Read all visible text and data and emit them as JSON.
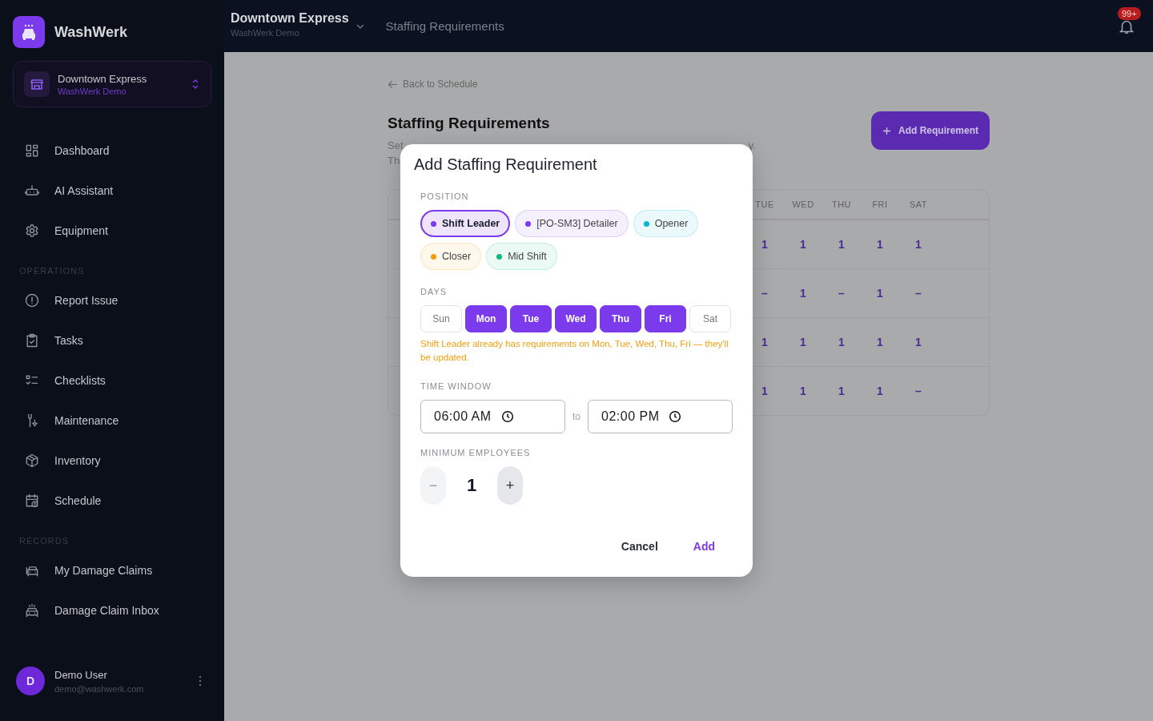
{
  "sidebar": {
    "brand": "WashWerk",
    "store": {
      "name": "Downtown Express",
      "org": "WashWerk Demo"
    },
    "sections": [
      {
        "items": [
          {
            "label": "Dashboard",
            "kind": "grid"
          },
          {
            "label": "AI Assistant",
            "kind": "robot"
          },
          {
            "label": "Equipment",
            "kind": "gear"
          }
        ]
      },
      {
        "title": "OPERATIONS",
        "items": [
          {
            "label": "Report Issue",
            "kind": "alert"
          },
          {
            "label": "Tasks",
            "kind": "clipboard"
          },
          {
            "label": "Checklists",
            "kind": "checklist"
          },
          {
            "label": "Maintenance",
            "kind": "wrench"
          },
          {
            "label": "Inventory",
            "kind": "box"
          },
          {
            "label": "Schedule",
            "kind": "calendar"
          }
        ]
      },
      {
        "title": "RECORDS",
        "items": [
          {
            "label": "My Damage Claims",
            "kind": "cars"
          },
          {
            "label": "Damage Claim Inbox",
            "kind": "siren-car"
          }
        ]
      }
    ],
    "user": {
      "initial": "D",
      "name": "Demo User",
      "email": "demo@washwerk.com"
    }
  },
  "topbar": {
    "store": "Downtown Express",
    "org": "WashWerk Demo",
    "page_title": "Staffing Requirements",
    "notifications": "99+"
  },
  "page": {
    "back_link": "Back to Schedule",
    "title": "Staffing Requirements",
    "description": {
      "line_1_left": "Set",
      "line_1_right": "y.",
      "line_2_left": "Th"
    },
    "add_button": "Add Requirement",
    "table": {
      "columns": [
        "TUE",
        "WED",
        "THU",
        "FRI",
        "SAT"
      ],
      "rows": [
        [
          "1",
          "1",
          "1",
          "1",
          "1"
        ],
        [
          "–",
          "1",
          "–",
          "1",
          "–"
        ],
        [
          "1",
          "1",
          "1",
          "1",
          "1"
        ],
        [
          "1",
          "1",
          "1",
          "1",
          "–"
        ]
      ]
    }
  },
  "dialog": {
    "title": "Add Staffing Requirement",
    "position_label": "POSITION",
    "positions": [
      {
        "label": "Shift Leader",
        "color": "#7c3aed",
        "selected": true
      },
      {
        "label": "[PO-SM3] Detailer",
        "color": "#7c3aed",
        "selected": false
      },
      {
        "label": "Opener",
        "color": "#06b6d4",
        "selected": false
      },
      {
        "label": "Closer",
        "color": "#f59e0b",
        "selected": false
      },
      {
        "label": "Mid Shift",
        "color": "#10b981",
        "selected": false
      }
    ],
    "days_label": "DAYS",
    "days": [
      {
        "label": "Sun",
        "selected": false
      },
      {
        "label": "Mon",
        "selected": true
      },
      {
        "label": "Tue",
        "selected": true
      },
      {
        "label": "Wed",
        "selected": true
      },
      {
        "label": "Thu",
        "selected": true
      },
      {
        "label": "Fri",
        "selected": true
      },
      {
        "label": "Sat",
        "selected": false
      }
    ],
    "warning": "Shift Leader already has requirements on Mon, Tue, Wed, Thu, Fri — they'll be updated.",
    "time_label": "TIME WINDOW",
    "start_time": "06:00 AM",
    "to": "to",
    "end_time": "02:00 PM",
    "min_label": "MINIMUM EMPLOYEES",
    "decrement": {
      "symbol": "−",
      "disabled": true
    },
    "count": "1",
    "increment": {
      "symbol": "+",
      "disabled": false
    },
    "cancel": "Cancel",
    "confirm": "Add"
  }
}
